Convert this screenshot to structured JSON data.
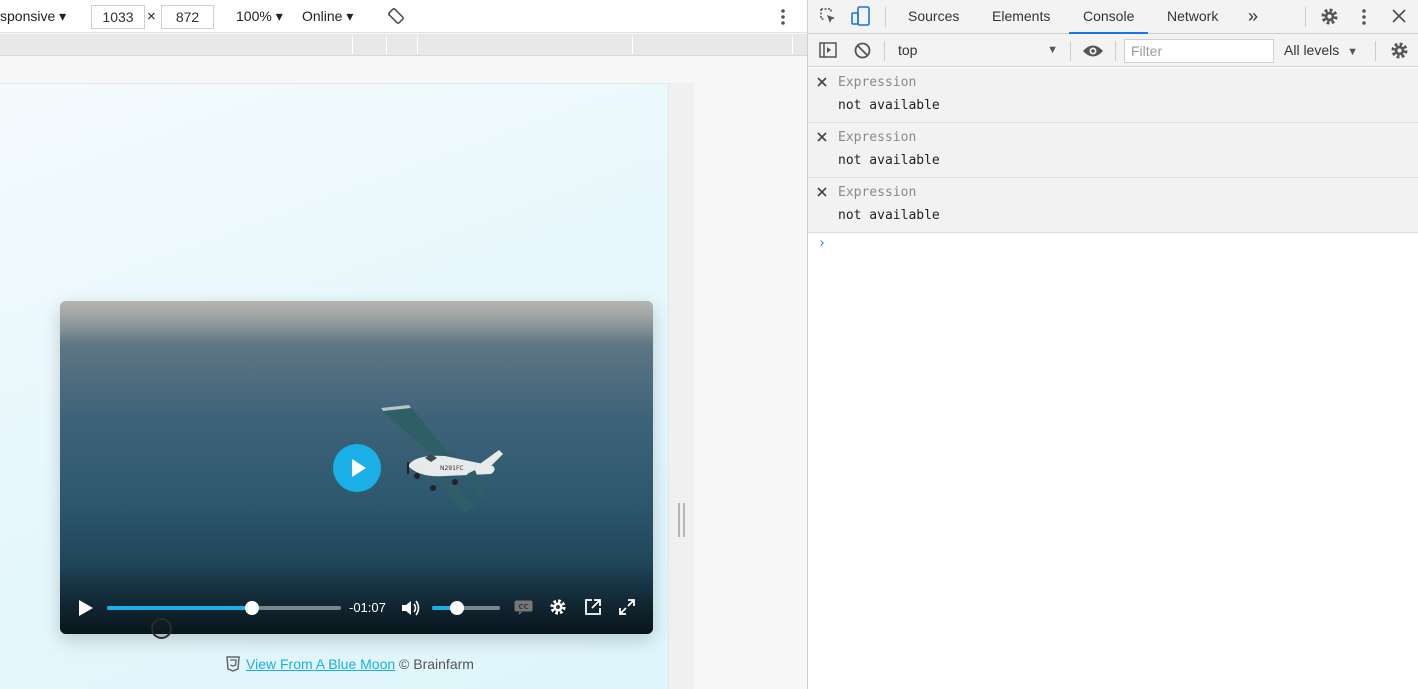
{
  "device_toolbar": {
    "device": "sponsive",
    "width": "1033",
    "times": "×",
    "height": "872",
    "zoom": "100%",
    "network": "Online"
  },
  "video": {
    "time_remaining": "-01:07",
    "progress": 0.62,
    "volume": 0.37,
    "cc_label": "CC"
  },
  "caption": {
    "link_text": "View From A Blue Moon",
    "suffix": " © Brainfarm"
  },
  "devtools": {
    "tabs": [
      {
        "label": "Sources"
      },
      {
        "label": "Elements"
      },
      {
        "label": "Console",
        "active": true
      },
      {
        "label": "Network"
      }
    ],
    "more_tabs": "»",
    "console_toolbar": {
      "context": "top",
      "filter_placeholder": "Filter",
      "levels": "All levels"
    },
    "expressions": [
      {
        "name": "Expression",
        "value": "not available"
      },
      {
        "name": "Expression",
        "value": "not available"
      },
      {
        "name": "Expression",
        "value": "not available"
      }
    ],
    "prompt": "›"
  },
  "colors": {
    "accent": "#1aafe6",
    "devtools_active_tab": "#1a73e8"
  },
  "icons": [
    "inspect-element-icon",
    "device-toggle-icon",
    "gear-icon",
    "kebab-menu-icon",
    "close-icon",
    "sidebar-toggle-icon",
    "clear-console-icon",
    "eye-icon",
    "rotate-icon",
    "play-icon",
    "volume-icon",
    "cc-icon",
    "pip-icon",
    "fullscreen-icon",
    "html5-icon"
  ]
}
